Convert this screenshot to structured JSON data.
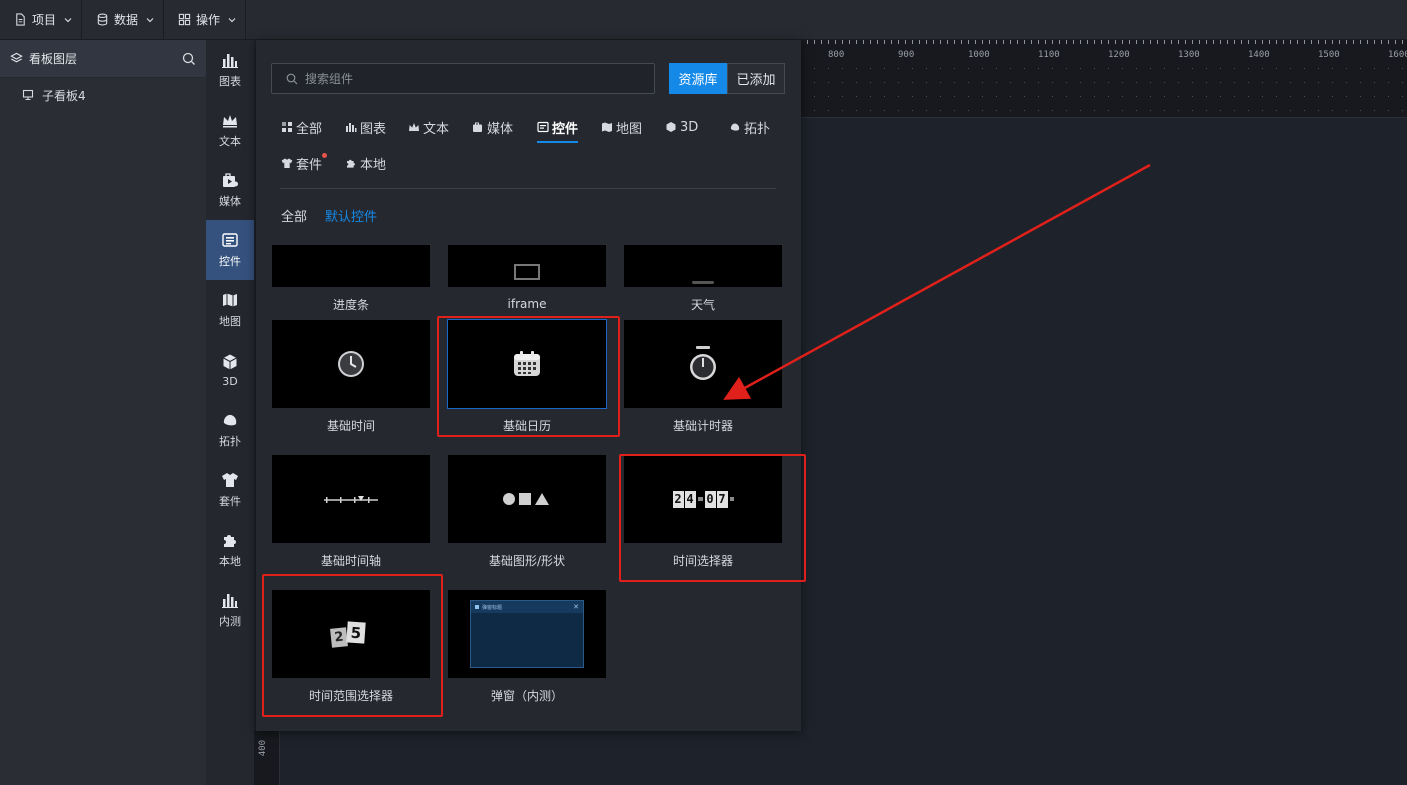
{
  "topbar": {
    "menus": [
      {
        "label": "项目",
        "icon": "file-icon"
      },
      {
        "label": "数据",
        "icon": "database-icon"
      },
      {
        "label": "操作",
        "icon": "grid-icon"
      }
    ]
  },
  "layers": {
    "title": "看板图层",
    "items": [
      {
        "label": "子看板4",
        "icon": "board-icon"
      }
    ]
  },
  "rail": {
    "items": [
      {
        "label": "图表",
        "icon": "bar-chart-icon"
      },
      {
        "label": "文本",
        "icon": "crown-icon"
      },
      {
        "label": "媒体",
        "icon": "media-icon"
      },
      {
        "label": "控件",
        "icon": "widget-icon",
        "active": true
      },
      {
        "label": "地图",
        "icon": "map-icon"
      },
      {
        "label": "3D",
        "icon": "cube-icon"
      },
      {
        "label": "拓扑",
        "icon": "topology-icon"
      },
      {
        "label": "套件",
        "icon": "shirt-icon"
      },
      {
        "label": "本地",
        "icon": "puzzle-icon"
      },
      {
        "label": "内测",
        "icon": "beta-chart-icon"
      }
    ]
  },
  "ruler": {
    "labels": [
      "800",
      "900",
      "1000",
      "1100",
      "1200",
      "1300",
      "1400",
      "1500",
      "1600"
    ],
    "left_label": "400"
  },
  "library": {
    "search_placeholder": "搜索组件",
    "toggle_on": "资源库",
    "toggle_off": "已添加",
    "tabs": [
      {
        "label": "全部",
        "icon": "apps-icon"
      },
      {
        "label": "图表",
        "icon": "bar-chart-icon"
      },
      {
        "label": "文本",
        "icon": "crown-icon"
      },
      {
        "label": "媒体",
        "icon": "media-icon"
      },
      {
        "label": "控件",
        "icon": "widget-icon",
        "active": true
      },
      {
        "label": "地图",
        "icon": "map-icon"
      },
      {
        "label": "3D",
        "icon": "cube-icon"
      },
      {
        "label": "拓扑",
        "icon": "topology-icon"
      },
      {
        "label": "套件",
        "icon": "shirt-icon",
        "badge": true
      },
      {
        "label": "本地",
        "icon": "puzzle-icon"
      }
    ],
    "subtabs": [
      {
        "label": "全部",
        "active": false
      },
      {
        "label": "默认控件",
        "active": true
      }
    ],
    "cards": [
      {
        "label": "进度条",
        "thumb": "progress"
      },
      {
        "label": "iframe",
        "thumb": "iframe"
      },
      {
        "label": "天气",
        "thumb": "weather"
      },
      {
        "label": "基础时间",
        "thumb": "clock"
      },
      {
        "label": "基础日历",
        "thumb": "calendar"
      },
      {
        "label": "基础计时器",
        "thumb": "timer"
      },
      {
        "label": "基础时间轴",
        "thumb": "timeline"
      },
      {
        "label": "基础图形/形状",
        "thumb": "shapes"
      },
      {
        "label": "时间选择器",
        "thumb": "flipdate"
      },
      {
        "label": "时间范围选择器",
        "thumb": "daterange"
      },
      {
        "label": "弹窗（内测）",
        "thumb": "popup"
      }
    ],
    "flip_digits": [
      "2",
      "4",
      "0",
      "7"
    ],
    "range_digits": [
      "2",
      "5"
    ],
    "popup_title": "弹窗标题"
  },
  "colors": {
    "accent": "#1589e8",
    "annotation": "#e0201a",
    "active_rail": "#35517e"
  }
}
